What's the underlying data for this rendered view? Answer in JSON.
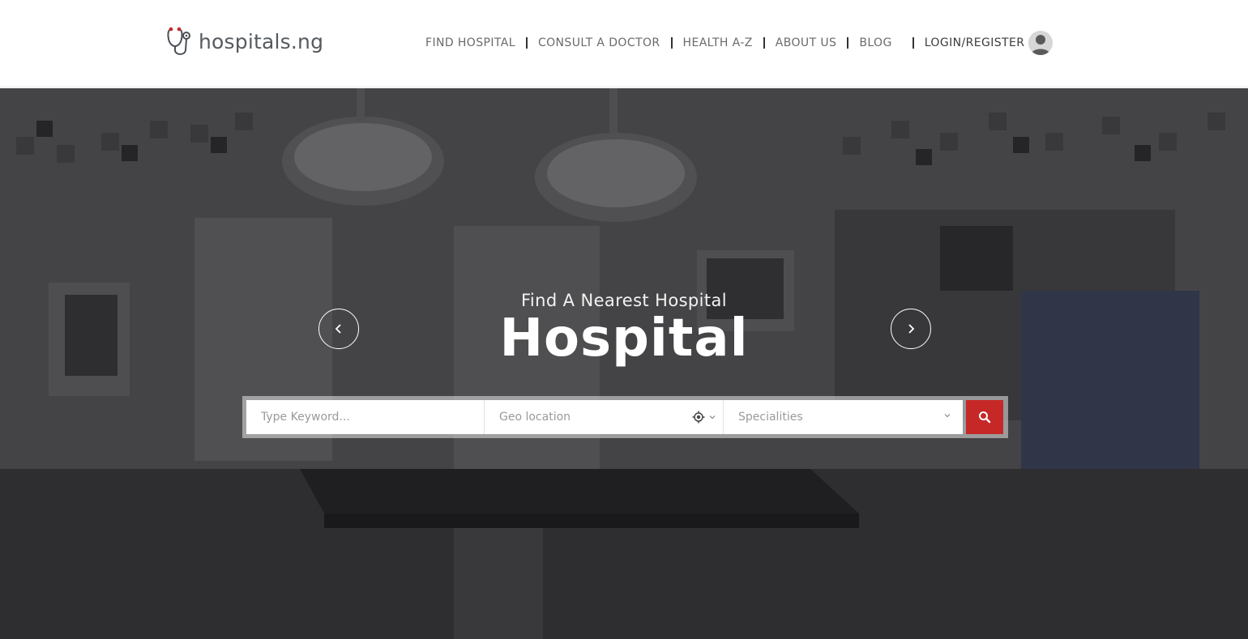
{
  "brand": {
    "name": "hospitals.ng",
    "accent_color": "#c62828",
    "logo_icon": "stethoscope-icon"
  },
  "nav": {
    "items": [
      {
        "label": "FIND HOSPITAL"
      },
      {
        "label": "CONSULT A DOCTOR"
      },
      {
        "label": "HEALTH A-Z"
      },
      {
        "label": "ABOUT US"
      },
      {
        "label": "BLOG"
      }
    ],
    "login_label": "LOGIN/REGISTER",
    "avatar_icon": "user-avatar-icon"
  },
  "hero": {
    "subtitle": "Find A Nearest Hospital",
    "title": "Hospital",
    "prev_icon": "chevron-left-icon",
    "next_icon": "chevron-right-icon"
  },
  "search": {
    "keyword_placeholder": "Type Keyword...",
    "geo_placeholder": "Geo location",
    "specialities_placeholder": "Specialities",
    "button_icon": "search-icon",
    "button_color": "#c62828"
  }
}
